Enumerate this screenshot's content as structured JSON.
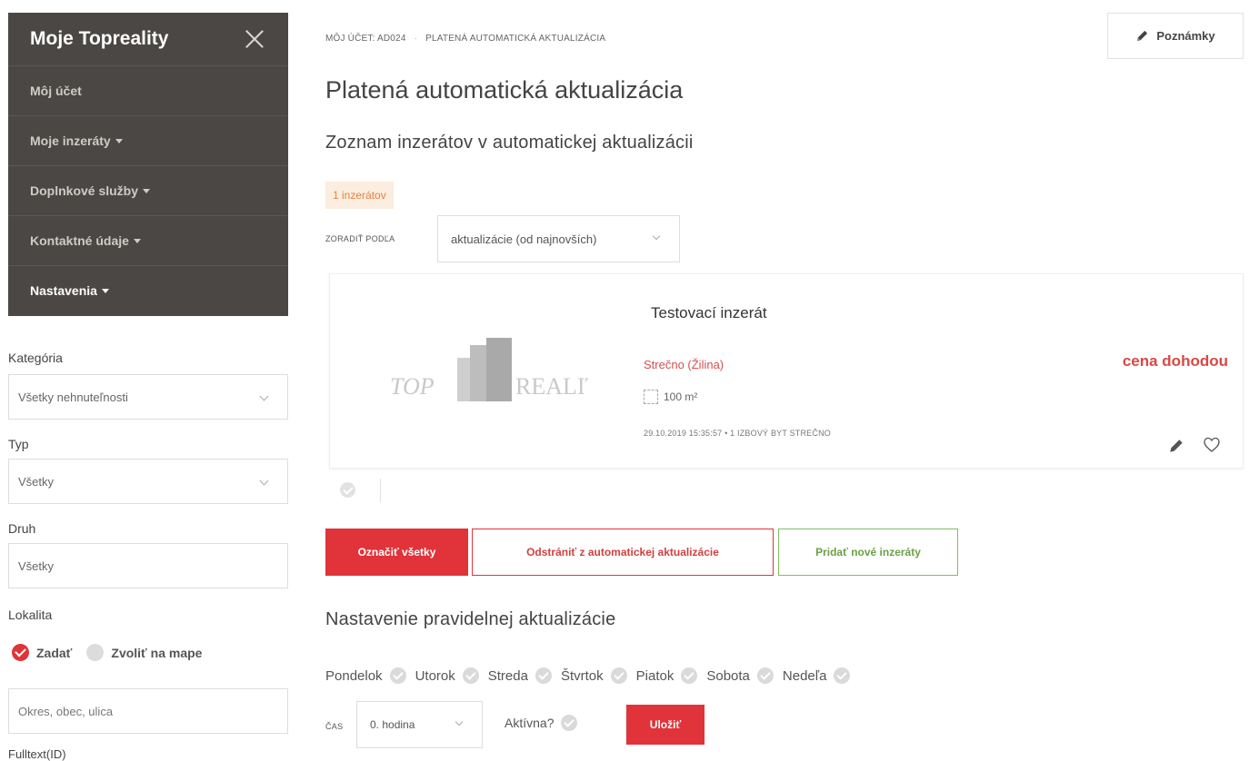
{
  "sidebar": {
    "title": "Moje Topreality",
    "items": [
      {
        "label": "Môj účet",
        "has_caret": false
      },
      {
        "label": "Moje inzeráty",
        "has_caret": true
      },
      {
        "label": "Doplnkové služby",
        "has_caret": true
      },
      {
        "label": "Kontaktné údaje",
        "has_caret": true
      },
      {
        "label": "Nastavenia",
        "has_caret": true
      }
    ]
  },
  "filters": {
    "category_label": "Kategória",
    "category_value": "Všetky nehnuteľnosti",
    "type_label": "Typ",
    "type_value": "Všetky",
    "kind_label": "Druh",
    "kind_value": "Všetky",
    "locality_label": "Lokalita",
    "locality_option_enter": "Zadať",
    "locality_option_map": "Zvoliť na mape",
    "locality_placeholder": "Okres, obec, ulica",
    "fulltext_label": "Fulltext(ID)"
  },
  "breadcrumb": {
    "account": "MÔJ ÚČET: AD024",
    "current": "PLATENÁ AUTOMATICKÁ AKTUALIZÁCIA"
  },
  "notes_button": "Poznámky",
  "page_title": "Platená automatická aktualizácia",
  "list_section_title": "Zoznam inzerátov v automatickej aktualizácii",
  "count_badge": "1 inzerátov",
  "sort": {
    "label": "ZORADIŤ PODĽA",
    "value": "aktualizácie (od najnovších)"
  },
  "listing": {
    "logo_text_left": "TOP",
    "logo_text_right": "REALITY",
    "title": "Testovací inzerát",
    "locality": "Strečno (Žilina)",
    "area": "100 m²",
    "meta": "29.10.2019 15:35:57  •  1 IZBOVÝ BYT STREČNO",
    "price": "cena dohodou"
  },
  "actions": {
    "select_all": "Označiť všetky",
    "remove": "Odstrániť z automatickej aktualizácie",
    "add": "Pridať nové inzeráty"
  },
  "schedule": {
    "title": "Nastavenie pravidelnej aktualizácie",
    "days": [
      "Pondelok",
      "Utorok",
      "Streda",
      "Štvrtok",
      "Piatok",
      "Sobota",
      "Nedeľa"
    ],
    "time_label": "ČAS",
    "time_value": "0. hodina",
    "active_label": "Aktívna?",
    "save": "Uložiť"
  },
  "colors": {
    "accent_red": "#e0333a",
    "sidebar_bg": "#4a4744",
    "badge_bg": "#fbeee0",
    "badge_text": "#e8833a",
    "green": "#7fbf5e"
  }
}
